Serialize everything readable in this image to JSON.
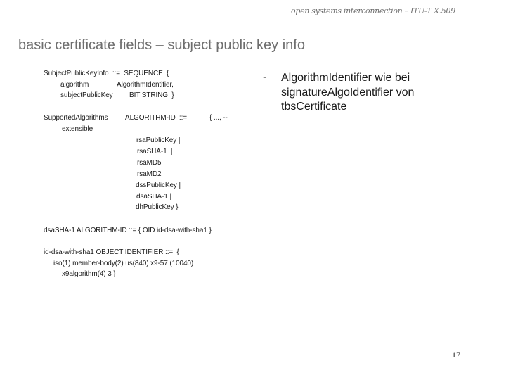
{
  "header": {
    "text": "open systems interconnection – ITU-T X.509"
  },
  "slide": {
    "title": "basic certificate fields – subject public key info",
    "page_number": "17"
  },
  "code": {
    "subject_public_key_info": [
      "SubjectPublicKeyInfo  ::=  SEQUENCE  {",
      "algorithm",
      "AlgorithmIdentifier,",
      "subjectPublicKey",
      "BIT STRING  }"
    ],
    "supported_algorithms": {
      "name": "SupportedAlgorithms",
      "type": "ALGORITHM-ID  ::=",
      "open": "{ ..., --",
      "extensible": "extensible",
      "items": [
        "rsaPublicKey |",
        "rsaSHA-1  |",
        "rsaMD5 |",
        "rsaMD2 |",
        "dssPublicKey |",
        "dsaSHA-1 |",
        "dhPublicKey }"
      ]
    },
    "dsa_sha1_def": "dsaSHA-1 ALGORITHM-ID ::= { OID id-dsa-with-sha1 }",
    "oid_def": [
      "id-dsa-with-sha1 OBJECT IDENTIFIER ::=  {",
      "iso(1) member-body(2) us(840) x9-57 (10040)",
      "x9algorithm(4) 3 }"
    ]
  },
  "note": {
    "bullet": "-",
    "text": "AlgorithmIdentifier wie bei signatureAlgoIdentifier von tbsCertificate"
  }
}
